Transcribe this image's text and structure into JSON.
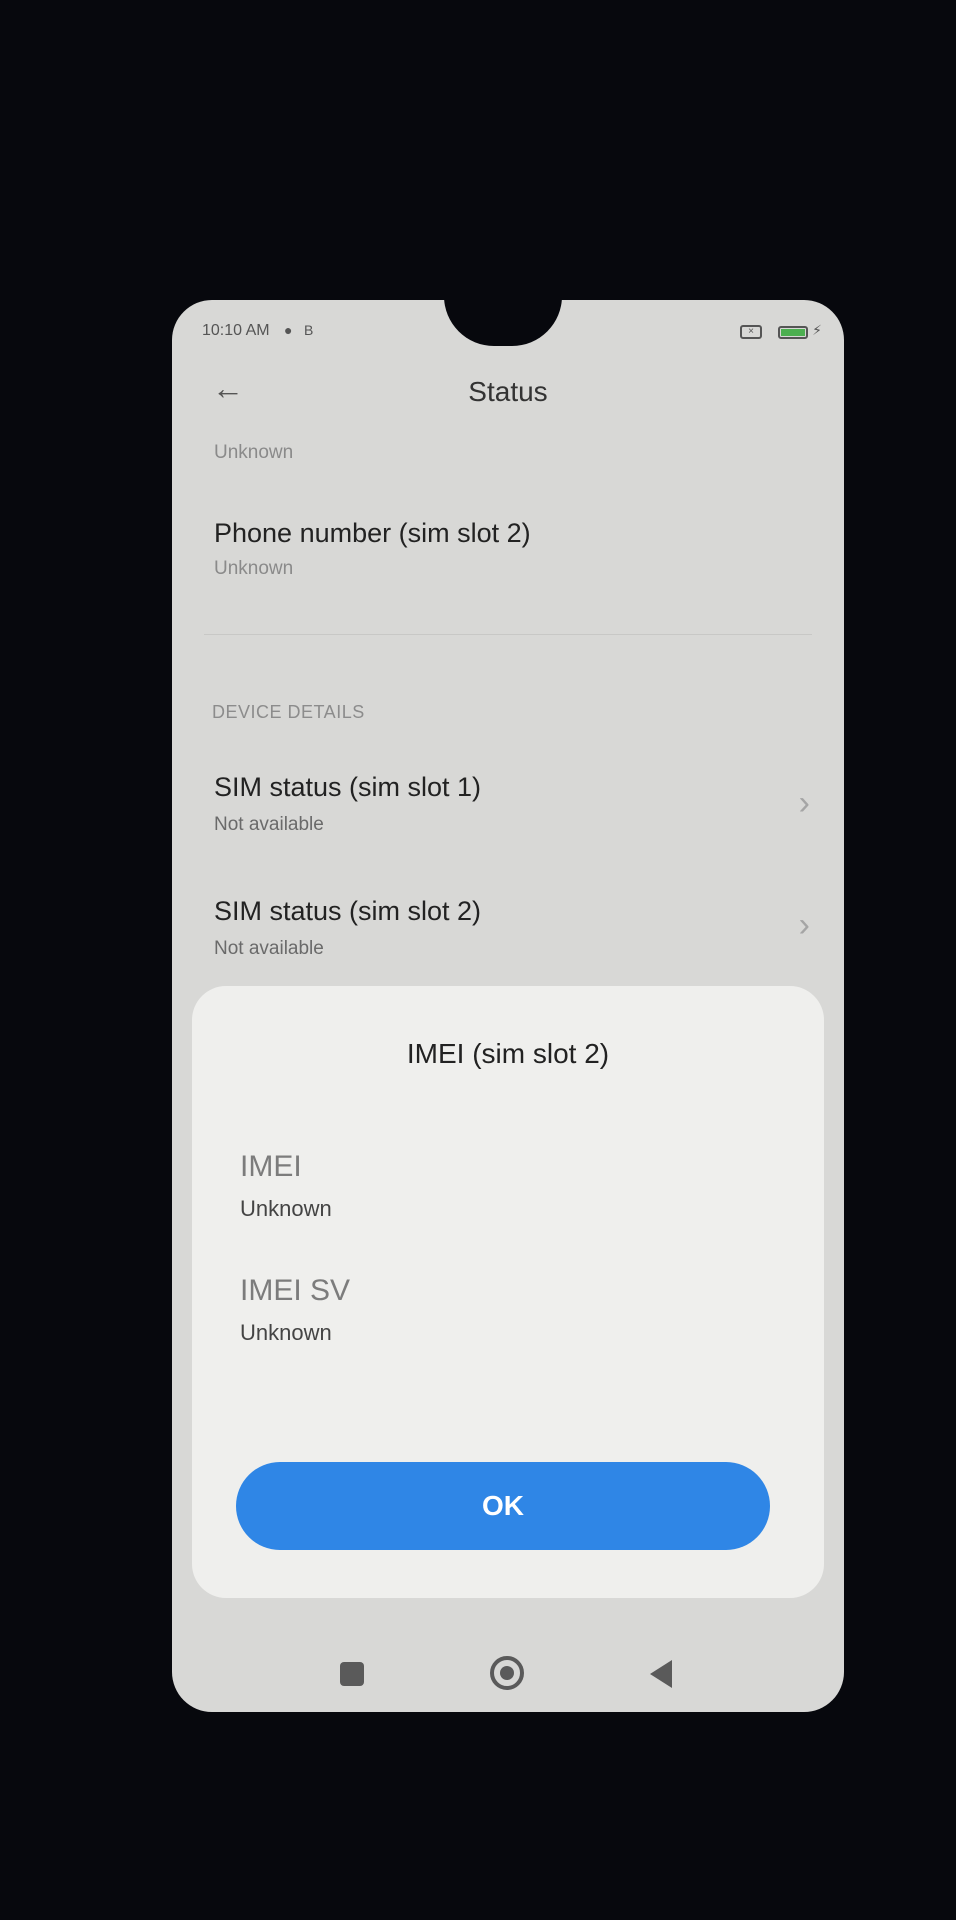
{
  "statusbar": {
    "time": "10:10 AM",
    "icons": [
      "shield-icon",
      "b-icon",
      "sim-x-icon",
      "battery-icon",
      "charging-icon"
    ],
    "battery_color": "#4caf50"
  },
  "header": {
    "back_icon": "arrow-left-icon",
    "title": "Status"
  },
  "content": {
    "prev_value": "Unknown",
    "phone_number_slot2": {
      "label": "Phone number (sim slot 2)",
      "value": "Unknown"
    },
    "section_device_details": "DEVICE DETAILS",
    "sim_status_slot1": {
      "label": "SIM status (sim slot 1)",
      "value": "Not available"
    },
    "sim_status_slot2": {
      "label": "SIM status (sim slot 2)",
      "value": "Not available"
    }
  },
  "dialog": {
    "title": "IMEI (sim slot 2)",
    "items": [
      {
        "label": "IMEI",
        "value": "Unknown"
      },
      {
        "label": "IMEI SV",
        "value": "Unknown"
      }
    ],
    "ok_label": "OK",
    "accent_color": "#2f86e6"
  },
  "navbar": {
    "recents_icon": "square-icon",
    "home_icon": "home-circle-icon",
    "back_icon": "triangle-back-icon"
  }
}
